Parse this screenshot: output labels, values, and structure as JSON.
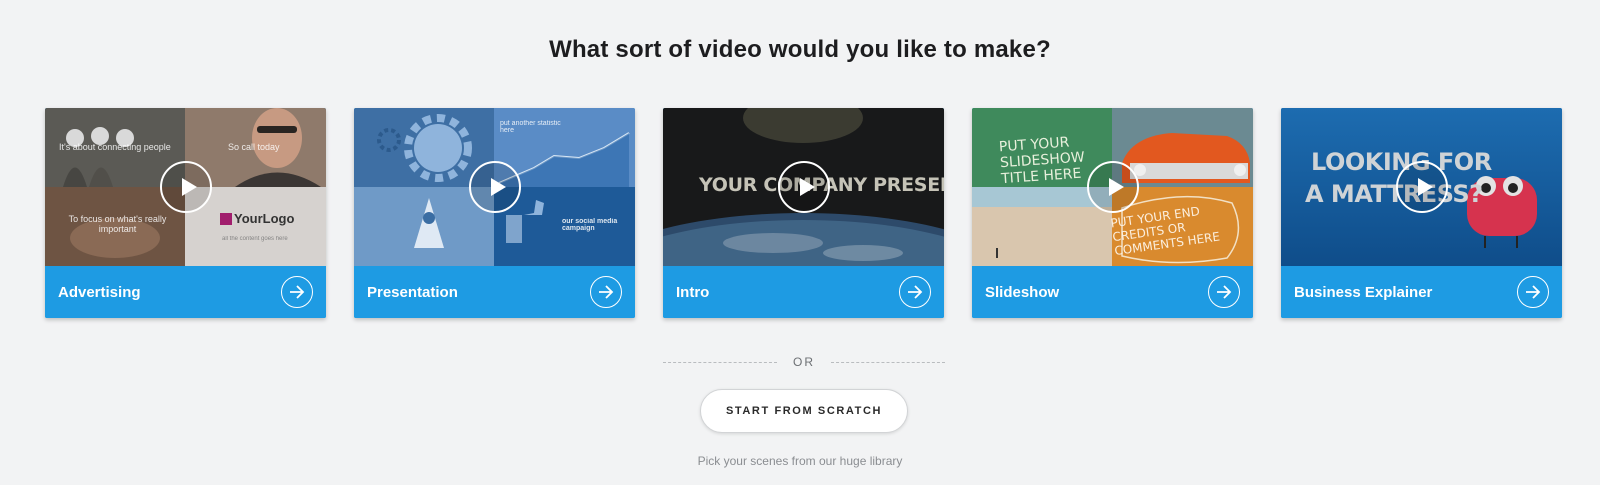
{
  "heading": "What sort of video would you like to make?",
  "colors": {
    "accent": "#1e9be3",
    "background": "#f2f3f4"
  },
  "cards": [
    {
      "label": "Advertising",
      "thumb_texts": [
        "It's about connecting people",
        "So call today",
        "To focus on what's really important",
        "YourLogo",
        "all the content goes here"
      ]
    },
    {
      "label": "Presentation",
      "thumb_texts": [
        "put another statistic here",
        "our social media campaign"
      ]
    },
    {
      "label": "Intro",
      "thumb_texts": [
        "YOUR COMPANY PRESENTS"
      ]
    },
    {
      "label": "Slideshow",
      "thumb_texts": [
        "PUT YOUR SLIDESHOW TITLE HERE",
        "PUT YOUR END CREDITS OR COMMENTS HERE"
      ]
    },
    {
      "label": "Business Explainer",
      "thumb_texts": [
        "LOOKING FOR",
        "A MATTRESS?"
      ]
    }
  ],
  "divider": {
    "or_label": "OR"
  },
  "scratch_button": {
    "label": "START FROM SCRATCH"
  },
  "subtitle": "Pick your scenes from our huge library",
  "icons": {
    "play": "play-icon",
    "arrow": "arrow-right-icon"
  }
}
